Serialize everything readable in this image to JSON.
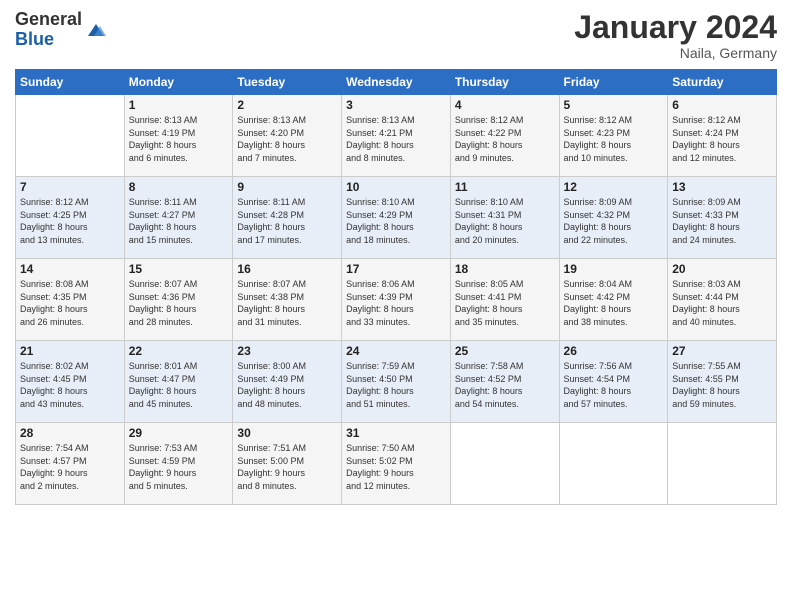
{
  "logo": {
    "general": "General",
    "blue": "Blue"
  },
  "header": {
    "month_year": "January 2024",
    "location": "Naila, Germany"
  },
  "days_of_week": [
    "Sunday",
    "Monday",
    "Tuesday",
    "Wednesday",
    "Thursday",
    "Friday",
    "Saturday"
  ],
  "weeks": [
    [
      {
        "day": "",
        "content": ""
      },
      {
        "day": "1",
        "content": "Sunrise: 8:13 AM\nSunset: 4:19 PM\nDaylight: 8 hours\nand 6 minutes."
      },
      {
        "day": "2",
        "content": "Sunrise: 8:13 AM\nSunset: 4:20 PM\nDaylight: 8 hours\nand 7 minutes."
      },
      {
        "day": "3",
        "content": "Sunrise: 8:13 AM\nSunset: 4:21 PM\nDaylight: 8 hours\nand 8 minutes."
      },
      {
        "day": "4",
        "content": "Sunrise: 8:12 AM\nSunset: 4:22 PM\nDaylight: 8 hours\nand 9 minutes."
      },
      {
        "day": "5",
        "content": "Sunrise: 8:12 AM\nSunset: 4:23 PM\nDaylight: 8 hours\nand 10 minutes."
      },
      {
        "day": "6",
        "content": "Sunrise: 8:12 AM\nSunset: 4:24 PM\nDaylight: 8 hours\nand 12 minutes."
      }
    ],
    [
      {
        "day": "7",
        "content": "Sunrise: 8:12 AM\nSunset: 4:25 PM\nDaylight: 8 hours\nand 13 minutes."
      },
      {
        "day": "8",
        "content": "Sunrise: 8:11 AM\nSunset: 4:27 PM\nDaylight: 8 hours\nand 15 minutes."
      },
      {
        "day": "9",
        "content": "Sunrise: 8:11 AM\nSunset: 4:28 PM\nDaylight: 8 hours\nand 17 minutes."
      },
      {
        "day": "10",
        "content": "Sunrise: 8:10 AM\nSunset: 4:29 PM\nDaylight: 8 hours\nand 18 minutes."
      },
      {
        "day": "11",
        "content": "Sunrise: 8:10 AM\nSunset: 4:31 PM\nDaylight: 8 hours\nand 20 minutes."
      },
      {
        "day": "12",
        "content": "Sunrise: 8:09 AM\nSunset: 4:32 PM\nDaylight: 8 hours\nand 22 minutes."
      },
      {
        "day": "13",
        "content": "Sunrise: 8:09 AM\nSunset: 4:33 PM\nDaylight: 8 hours\nand 24 minutes."
      }
    ],
    [
      {
        "day": "14",
        "content": "Sunrise: 8:08 AM\nSunset: 4:35 PM\nDaylight: 8 hours\nand 26 minutes."
      },
      {
        "day": "15",
        "content": "Sunrise: 8:07 AM\nSunset: 4:36 PM\nDaylight: 8 hours\nand 28 minutes."
      },
      {
        "day": "16",
        "content": "Sunrise: 8:07 AM\nSunset: 4:38 PM\nDaylight: 8 hours\nand 31 minutes."
      },
      {
        "day": "17",
        "content": "Sunrise: 8:06 AM\nSunset: 4:39 PM\nDaylight: 8 hours\nand 33 minutes."
      },
      {
        "day": "18",
        "content": "Sunrise: 8:05 AM\nSunset: 4:41 PM\nDaylight: 8 hours\nand 35 minutes."
      },
      {
        "day": "19",
        "content": "Sunrise: 8:04 AM\nSunset: 4:42 PM\nDaylight: 8 hours\nand 38 minutes."
      },
      {
        "day": "20",
        "content": "Sunrise: 8:03 AM\nSunset: 4:44 PM\nDaylight: 8 hours\nand 40 minutes."
      }
    ],
    [
      {
        "day": "21",
        "content": "Sunrise: 8:02 AM\nSunset: 4:45 PM\nDaylight: 8 hours\nand 43 minutes."
      },
      {
        "day": "22",
        "content": "Sunrise: 8:01 AM\nSunset: 4:47 PM\nDaylight: 8 hours\nand 45 minutes."
      },
      {
        "day": "23",
        "content": "Sunrise: 8:00 AM\nSunset: 4:49 PM\nDaylight: 8 hours\nand 48 minutes."
      },
      {
        "day": "24",
        "content": "Sunrise: 7:59 AM\nSunset: 4:50 PM\nDaylight: 8 hours\nand 51 minutes."
      },
      {
        "day": "25",
        "content": "Sunrise: 7:58 AM\nSunset: 4:52 PM\nDaylight: 8 hours\nand 54 minutes."
      },
      {
        "day": "26",
        "content": "Sunrise: 7:56 AM\nSunset: 4:54 PM\nDaylight: 8 hours\nand 57 minutes."
      },
      {
        "day": "27",
        "content": "Sunrise: 7:55 AM\nSunset: 4:55 PM\nDaylight: 8 hours\nand 59 minutes."
      }
    ],
    [
      {
        "day": "28",
        "content": "Sunrise: 7:54 AM\nSunset: 4:57 PM\nDaylight: 9 hours\nand 2 minutes."
      },
      {
        "day": "29",
        "content": "Sunrise: 7:53 AM\nSunset: 4:59 PM\nDaylight: 9 hours\nand 5 minutes."
      },
      {
        "day": "30",
        "content": "Sunrise: 7:51 AM\nSunset: 5:00 PM\nDaylight: 9 hours\nand 8 minutes."
      },
      {
        "day": "31",
        "content": "Sunrise: 7:50 AM\nSunset: 5:02 PM\nDaylight: 9 hours\nand 12 minutes."
      },
      {
        "day": "",
        "content": ""
      },
      {
        "day": "",
        "content": ""
      },
      {
        "day": "",
        "content": ""
      }
    ]
  ]
}
